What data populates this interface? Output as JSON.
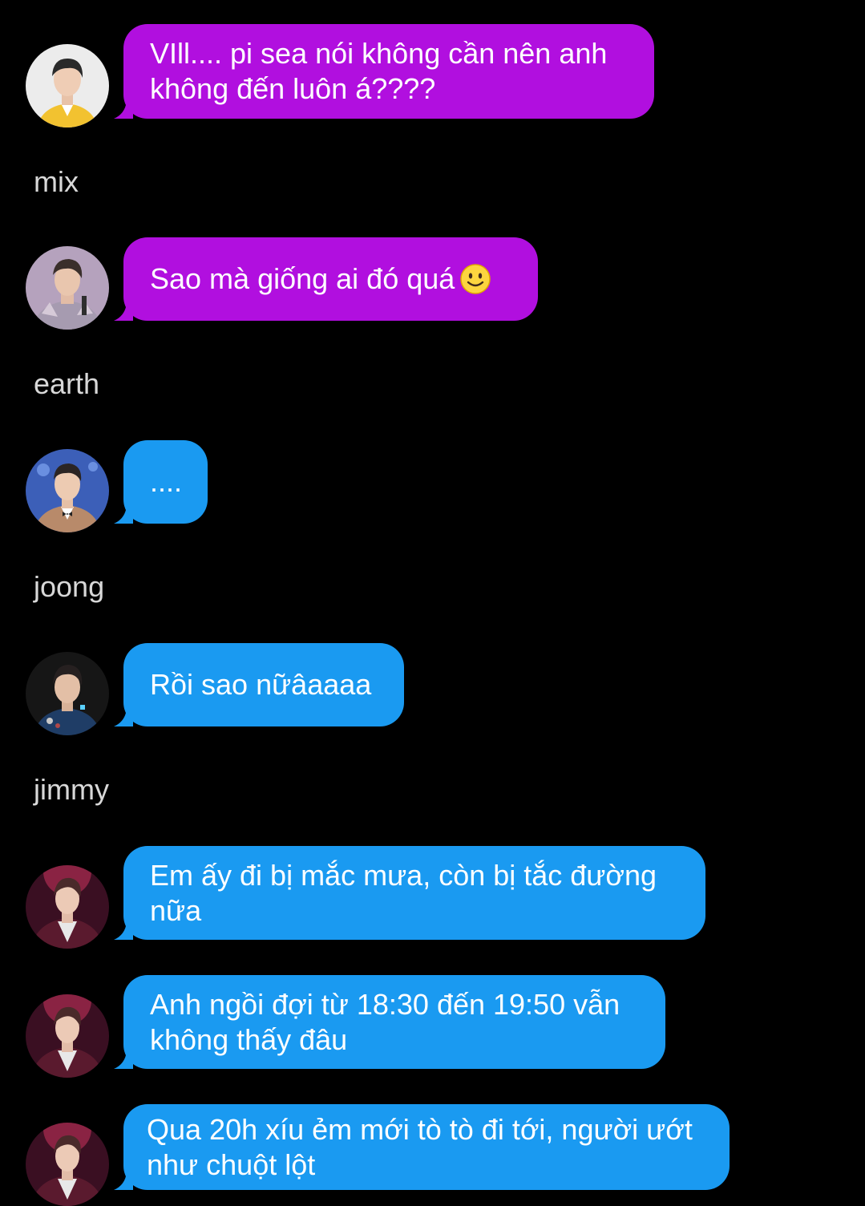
{
  "colors": {
    "background": "#000000",
    "bubble_purple": "#b10fdf",
    "bubble_blue": "#1a9af1",
    "name_text": "#d8d8d8",
    "message_text": "#ffffff"
  },
  "messages": [
    {
      "id": "m1",
      "avatar_icon": "avatar-mix-icon",
      "color": "purple",
      "lines": [
        "VIll.... pi sea nói không cần nên anh",
        "không đến luôn á????"
      ]
    },
    {
      "id": "m2",
      "avatar_icon": "avatar-earth-icon",
      "color": "purple",
      "lines": [
        "Sao mà giống ai đó quá"
      ],
      "emoji": "slightly-smiling-face-icon"
    },
    {
      "id": "m3",
      "avatar_icon": "avatar-joong-icon",
      "color": "blue",
      "lines": [
        "...."
      ]
    },
    {
      "id": "m4",
      "avatar_icon": "avatar-jimmy-icon",
      "color": "blue",
      "lines": [
        "Rồi sao nữâaaaa"
      ]
    },
    {
      "id": "m5",
      "avatar_icon": "avatar-icon",
      "color": "blue",
      "lines": [
        "Em ấy đi bị mắc mưa, còn bị tắc đường",
        "nữa"
      ]
    },
    {
      "id": "m6",
      "avatar_icon": "avatar-icon",
      "color": "blue",
      "lines": [
        "Anh ngồi đợi từ 18:30 đến 19:50 vẫn",
        "không thấy đâu"
      ]
    },
    {
      "id": "m7",
      "avatar_icon": "avatar-icon",
      "color": "blue",
      "lines": [
        "Qua 20h xíu ẻm mới tò tò đi tới, người ướt",
        "như chuột lột"
      ]
    }
  ],
  "names": [
    "mix",
    "earth",
    "joong",
    "jimmy"
  ]
}
